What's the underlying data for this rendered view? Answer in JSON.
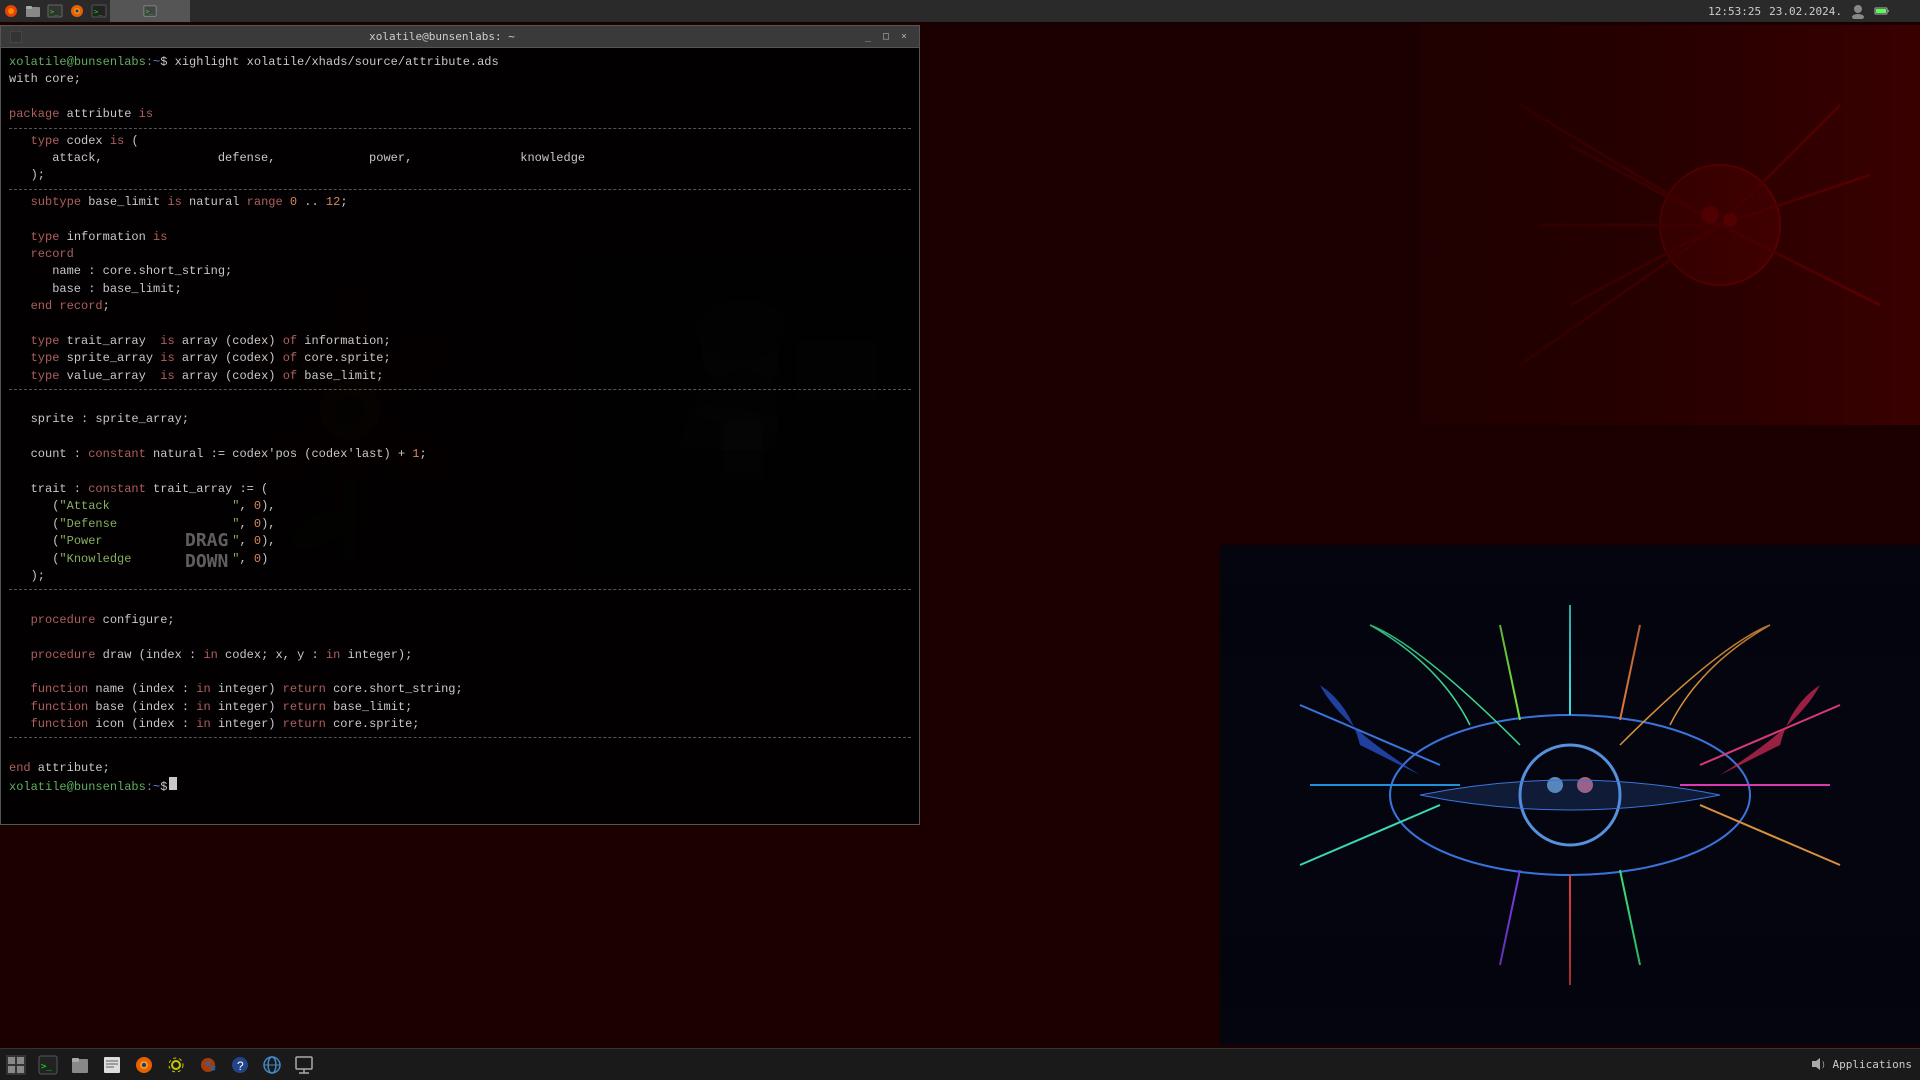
{
  "taskbar_top": {
    "icons": [
      {
        "name": "bunsen-icon",
        "symbol": "🔥"
      },
      {
        "name": "folder-icon",
        "symbol": "📁"
      },
      {
        "name": "terminal-icon",
        "symbol": "⬛"
      },
      {
        "name": "firefox-icon",
        "symbol": "🦊"
      },
      {
        "name": "terminal2-icon",
        "symbol": "⬛"
      },
      {
        "name": "app-icon",
        "symbol": "🗖"
      }
    ],
    "clock": "12:53:25",
    "date": "23.02.2024.",
    "battery_icon": "🔋"
  },
  "terminal": {
    "title": "xolatile@bunsenlabs: ~",
    "prompt_user": "xolatile",
    "prompt_at": "@",
    "prompt_host": "bunsenlabs",
    "prompt_separator": ":~$",
    "command": " xighlight xolatile/xhads/source/attribute.ads",
    "line2": "with core;",
    "line3": "",
    "line4": "package attribute is",
    "code_lines": [
      "",
      "   type codex is (",
      "      attack,                defense,             power,               knowledge",
      "   );",
      "",
      "",
      "",
      "   subtype base_limit is natural range 0 .. 12;",
      "",
      "   type information is",
      "   record",
      "      name : core.short_string;",
      "      base : base_limit;",
      "   end record;",
      "",
      "   type trait_array  is array (codex) of information;",
      "   type sprite_array is array (codex) of core.sprite;",
      "   type value_array  is array (codex) of base_limit;",
      "",
      "",
      "",
      "   sprite : sprite_array;",
      "",
      "   count : constant natural := codex'pos (codex'last) + 1;",
      "",
      "   trait : constant trait_array := (",
      "      (\"Attack                         \", 0),",
      "      (\"Defense                        \", 0),",
      "      (\"Power                          \", 0),",
      "      (\"Knowledge                      \", 0)",
      "   );",
      "",
      "",
      "",
      "   procedure configure;",
      "",
      "   procedure draw (index : in codex; x, y : in integer);",
      "",
      "   function name (index : in integer) return core.short_string;",
      "   function base (index : in integer) return base_limit;",
      "   function icon (index : in integer) return core.sprite;",
      "",
      "",
      "",
      "end attribute;",
      "xolatile@bunsenlabs:~$"
    ]
  },
  "taskbar_bottom": {
    "icons": [
      {
        "name": "start-icon",
        "symbol": "🔲"
      },
      {
        "name": "terminal-icon2",
        "symbol": "⬛"
      },
      {
        "name": "files-icon",
        "symbol": "📂"
      },
      {
        "name": "text-icon",
        "symbol": "📝"
      },
      {
        "name": "firefox-icon2",
        "symbol": "🦊"
      },
      {
        "name": "settings-icon",
        "symbol": "⚙"
      },
      {
        "name": "extras-icon",
        "symbol": "🐾"
      },
      {
        "name": "help-icon",
        "symbol": "❓"
      },
      {
        "name": "web-icon",
        "symbol": "🌐"
      },
      {
        "name": "system-icon",
        "symbol": "🔧"
      }
    ],
    "applications_label": "Applications",
    "volume_icon": "🔊"
  }
}
